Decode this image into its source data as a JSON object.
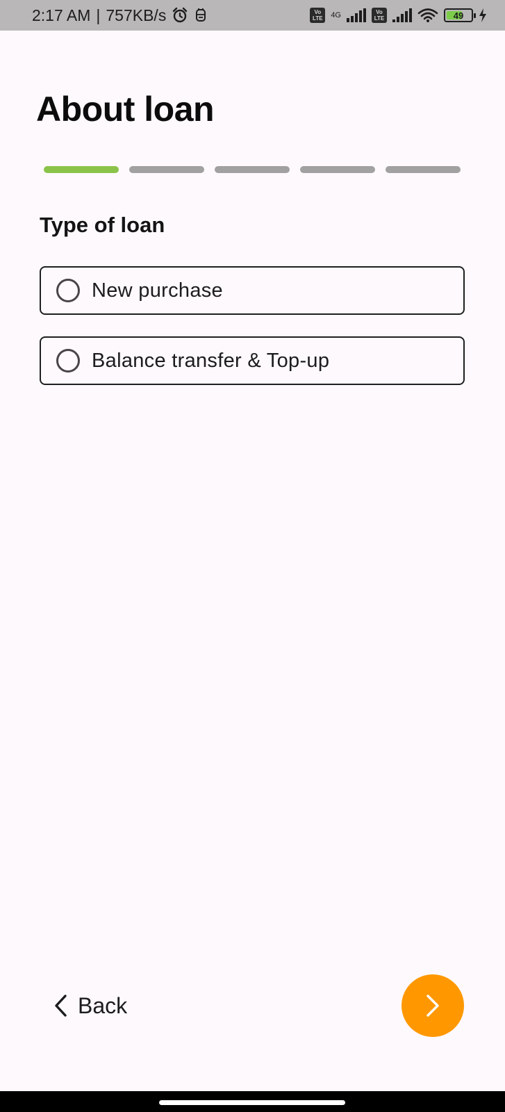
{
  "status_bar": {
    "time": "2:17 AM",
    "separator": "|",
    "net_speed": "757KB/s",
    "network_type": "4G",
    "volte_label_top": "Vo",
    "volte_label_bottom": "LTE",
    "battery_level": "49",
    "icons": [
      "alarm-icon",
      "notification-icon",
      "volte-icon",
      "signal-icon",
      "wifi-icon",
      "battery-icon",
      "charging-icon"
    ]
  },
  "page": {
    "title": "About loan"
  },
  "progress": {
    "total_steps": 5,
    "current_step": 1,
    "active_color": "#8bc34a",
    "inactive_color": "#a1a1a1"
  },
  "loan_type": {
    "label": "Type of loan",
    "options": [
      {
        "label": "New purchase",
        "selected": false
      },
      {
        "label": "Balance transfer & Top-up",
        "selected": false
      }
    ]
  },
  "navigation": {
    "back_label": "Back",
    "back_icon": "chevron-left-icon",
    "next_icon": "chevron-right-icon",
    "next_color": "#ff9800"
  }
}
